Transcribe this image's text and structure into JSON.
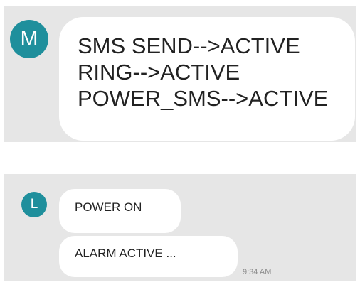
{
  "conversation_1": {
    "avatar_letter": "M",
    "message_lines": [
      "SMS SEND-->ACTIVE",
      "RING-->ACTIVE",
      "POWER_SMS-->ACTIVE"
    ]
  },
  "conversation_2": {
    "avatar_letter": "L",
    "messages": [
      "POWER ON",
      "ALARM ACTIVE ..."
    ],
    "timestamp": "9:34 AM"
  },
  "colors": {
    "avatar_bg": "#1f8f9c",
    "panel_bg": "#e6e6e6",
    "bubble_bg": "#ffffff"
  }
}
